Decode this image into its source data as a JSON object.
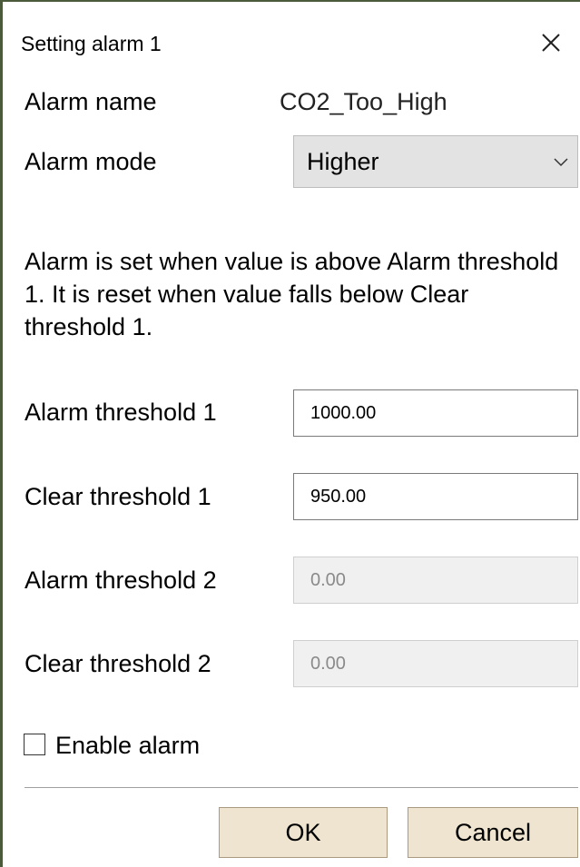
{
  "dialog": {
    "title": "Setting alarm 1",
    "close_icon": "close-icon"
  },
  "form": {
    "alarm_name_label": "Alarm name",
    "alarm_name_value": "CO2_Too_High",
    "alarm_mode_label": "Alarm mode",
    "alarm_mode_value": "Higher",
    "description": "Alarm is set when value is above Alarm threshold 1. It is reset when value falls below Clear threshold 1.",
    "alarm_threshold_1_label": "Alarm threshold 1",
    "alarm_threshold_1_value": "1000.00",
    "clear_threshold_1_label": "Clear threshold 1",
    "clear_threshold_1_value": "950.00",
    "alarm_threshold_2_label": "Alarm threshold 2",
    "alarm_threshold_2_value": "0.00",
    "clear_threshold_2_label": "Clear threshold 2",
    "clear_threshold_2_value": "0.00",
    "enable_alarm_label": "Enable alarm",
    "enable_alarm_checked": false
  },
  "buttons": {
    "ok_label": "OK",
    "cancel_label": "Cancel"
  },
  "colors": {
    "button_bg": "#efe4cf",
    "select_bg": "#e3e3e3",
    "disabled_bg": "#f0f0f0",
    "disabled_text": "#8a8a8a"
  }
}
